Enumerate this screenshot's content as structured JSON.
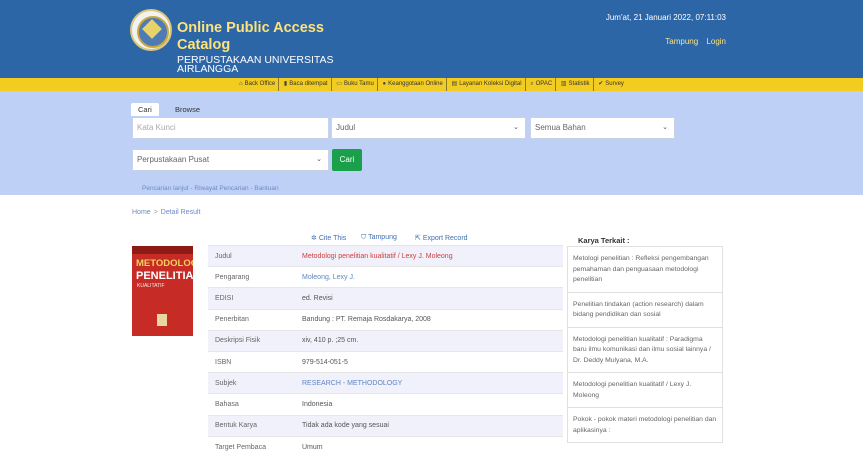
{
  "header": {
    "title_line1": "Online Public Access",
    "title_line2": "Catalog",
    "university": "PERPUSTAKAAN UNIVERSITAS AIRLANGGA",
    "datetime": "Jum'at, 21 Januari 2022, 07:11:03",
    "links": [
      "Tampung",
      "Login"
    ]
  },
  "navbar": {
    "items": [
      {
        "icon": "home-icon",
        "label": "Back Office"
      },
      {
        "icon": "book-icon",
        "label": "Baca ditempat"
      },
      {
        "icon": "book-open-icon",
        "label": "Buku Tamu"
      },
      {
        "icon": "user-icon",
        "label": "Keanggotaan Online"
      },
      {
        "icon": "layers-icon",
        "label": "Layanan Koleksi Digital"
      },
      {
        "icon": "search-icon",
        "label": "OPAC"
      },
      {
        "icon": "bar-chart-icon",
        "label": "Statistik"
      },
      {
        "icon": "check-icon",
        "label": "Survey"
      }
    ]
  },
  "search": {
    "tabs": [
      "Cari",
      "Browse"
    ],
    "keyword_placeholder": "Kata Kunci",
    "field_select": "Judul",
    "material_select": "Semua Bahan",
    "location_select": "Perpustakaan Pusat",
    "button": "Cari",
    "links": "Pencarian lanjut - Riwayat Pencarian - Bantuan"
  },
  "breadcrumb": {
    "home": "Home",
    "separator": ">",
    "current": "Detail Result"
  },
  "cover": {
    "line1": "METODOLOGI",
    "line2": "PENELITIAN",
    "line3": "KUALITATIF"
  },
  "actions": {
    "cite": "Cite This",
    "tampung": "Tampung",
    "export": "Export Record"
  },
  "detail": [
    {
      "label": "Judul",
      "value": "Metodologi penelitian kualitatif / Lexy J. Moleong",
      "style": "red"
    },
    {
      "label": "Pengarang",
      "value": "Moleong, Lexy J.",
      "style": "blue"
    },
    {
      "label": "EDISI",
      "value": "ed. Revisi",
      "style": ""
    },
    {
      "label": "Penerbitan",
      "value": "Bandung : PT. Remaja Rosdakarya, 2008",
      "style": ""
    },
    {
      "label": "Deskripsi Fisik",
      "value": "xiv, 410 p. ;25 cm.",
      "style": ""
    },
    {
      "label": "ISBN",
      "value": "979-514-051-5",
      "style": ""
    },
    {
      "label": "Subjek",
      "value": "RESEARCH - METHODOLOGY",
      "style": "blue"
    },
    {
      "label": "Bahasa",
      "value": "Indonesia",
      "style": ""
    },
    {
      "label": "Bentuk Karya",
      "value": "Tidak ada kode yang sesuai",
      "style": ""
    },
    {
      "label": "Target Pembaca",
      "value": "Umum",
      "style": ""
    }
  ],
  "related": {
    "title": "Karya Terkait :",
    "items": [
      "Metologi penelitian : Refleksi pengembangan pemahaman dan penguasaan metodologi penelitian",
      "Penelitian tindakan (action research) dalam bidang pendidikan dan sosial",
      "Metodologi penelitian kualitatif : Paradigma baru ilmu komunikasi dan ilmu sosial lainnya / Dr. Deddy Mulyana, M.A.",
      "Metodologi penelitian kualitatif / Lexy J. Moleong",
      "Pokok - pokok materi metodologi penelitian dan aplikasinya :"
    ]
  }
}
